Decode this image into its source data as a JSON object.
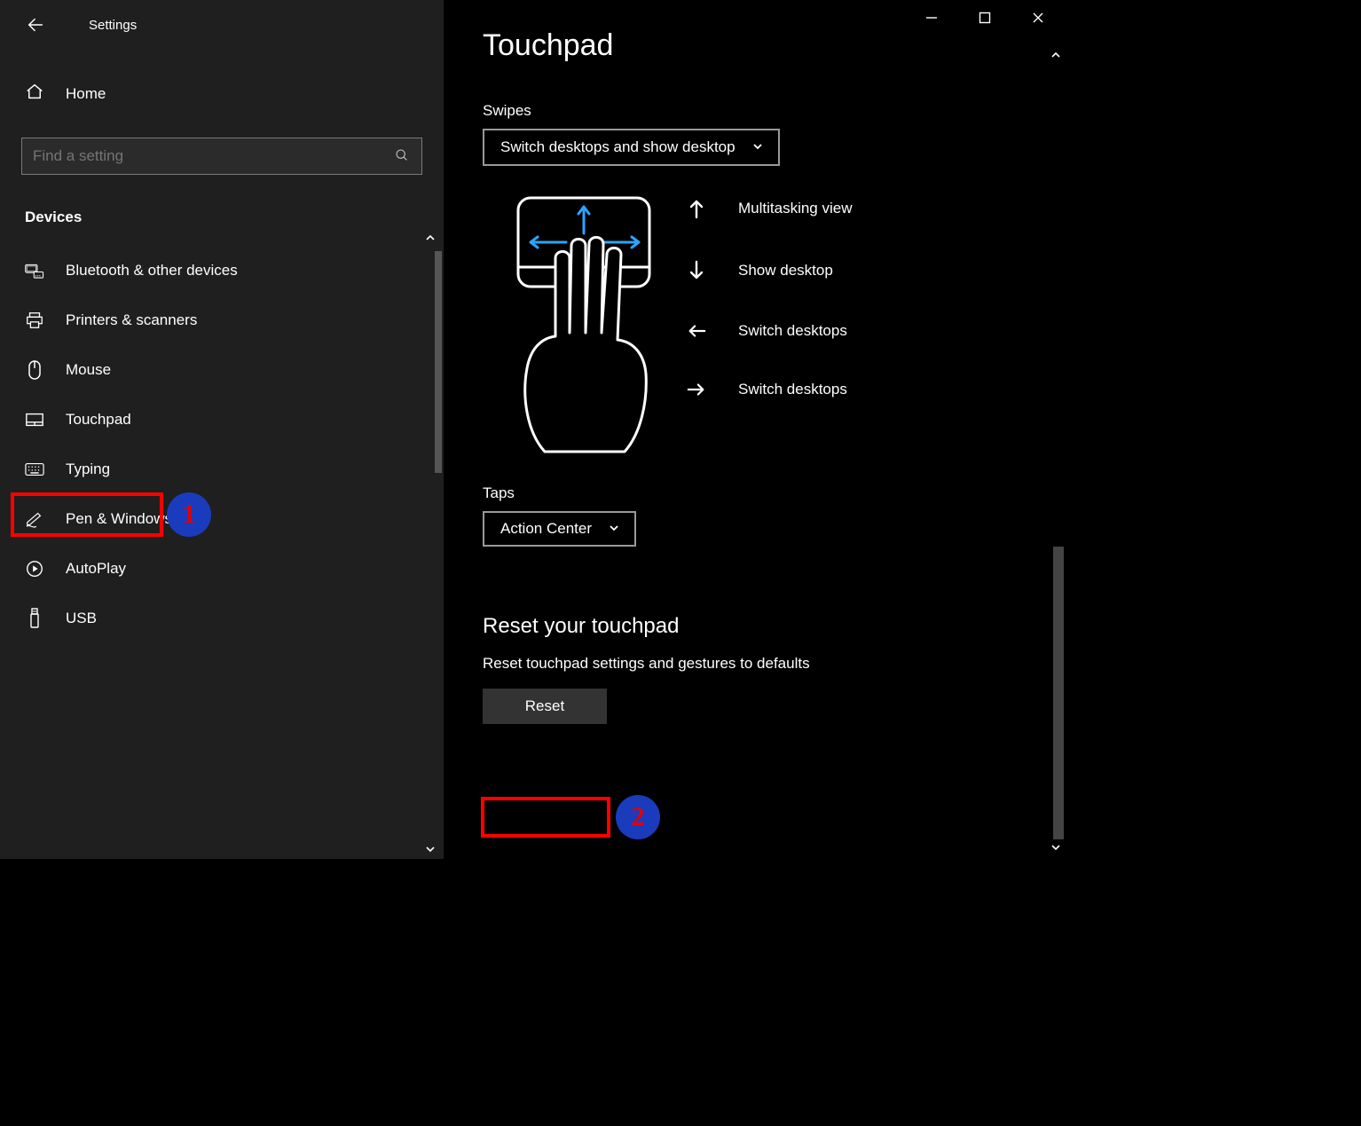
{
  "header": {
    "title": "Settings"
  },
  "sidebar": {
    "home_label": "Home",
    "search_placeholder": "Find a setting",
    "section_label": "Devices",
    "items": [
      {
        "icon": "bluetooth",
        "label": "Bluetooth & other devices"
      },
      {
        "icon": "printer",
        "label": "Printers & scanners"
      },
      {
        "icon": "mouse",
        "label": "Mouse"
      },
      {
        "icon": "touchpad",
        "label": "Touchpad"
      },
      {
        "icon": "keyboard",
        "label": "Typing"
      },
      {
        "icon": "pen",
        "label": "Pen & Windows Ink"
      },
      {
        "icon": "autoplay",
        "label": "AutoPlay"
      },
      {
        "icon": "usb",
        "label": "USB"
      }
    ]
  },
  "main": {
    "page_title": "Touchpad",
    "swipes": {
      "label": "Swipes",
      "selected": "Switch desktops and show desktop",
      "gestures": [
        {
          "dir": "up",
          "label": "Multitasking view"
        },
        {
          "dir": "down",
          "label": "Show desktop"
        },
        {
          "dir": "left",
          "label": "Switch desktops"
        },
        {
          "dir": "right",
          "label": "Switch desktops"
        }
      ]
    },
    "taps": {
      "label": "Taps",
      "selected": "Action Center"
    },
    "reset": {
      "heading": "Reset your touchpad",
      "description": "Reset touchpad settings and gestures to defaults",
      "button_label": "Reset"
    }
  },
  "annotations": [
    {
      "n": "1",
      "target": "sidebar-touchpad"
    },
    {
      "n": "2",
      "target": "reset-button"
    }
  ]
}
